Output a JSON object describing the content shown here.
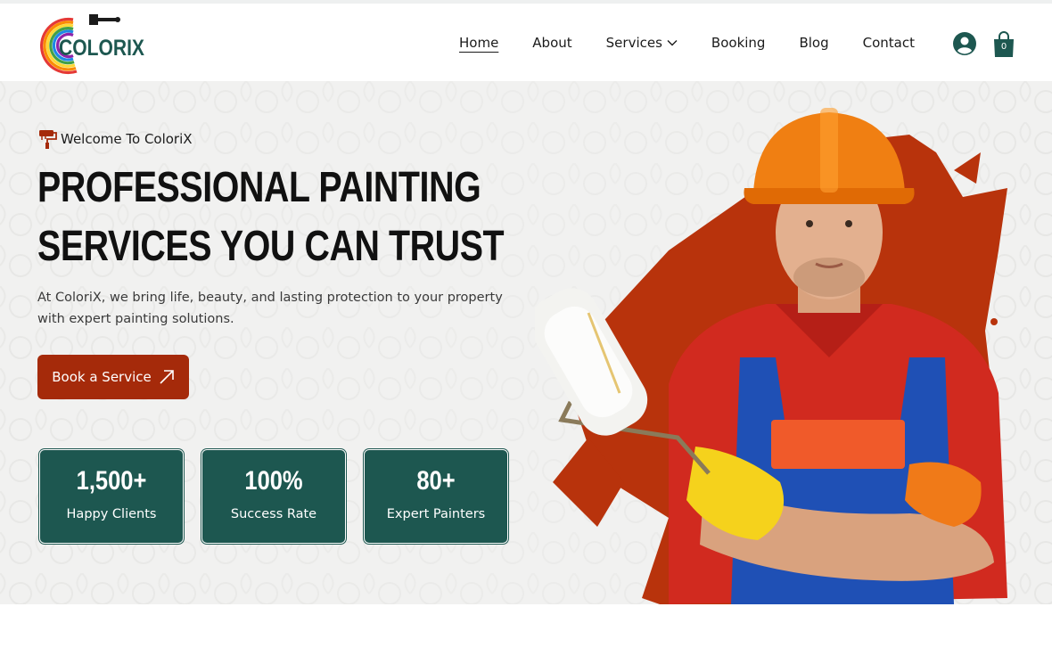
{
  "brand": {
    "logo_text": "COLORIX"
  },
  "nav": {
    "items": [
      {
        "label": "Home",
        "active": true
      },
      {
        "label": "About"
      },
      {
        "label": "Services",
        "has_dropdown": true
      },
      {
        "label": "Booking"
      },
      {
        "label": "Blog"
      },
      {
        "label": "Contact"
      }
    ]
  },
  "header": {
    "user_icon": "user-circle-icon",
    "cart_icon": "shopping-bag-icon",
    "cart_count": "0"
  },
  "hero": {
    "welcome": "Welcome To ColoriX",
    "title_line1": "PROFESSIONAL PAINTING",
    "title_line2": "SERVICES YOU CAN TRUST",
    "description": "At ColoriX, we bring life, beauty, and lasting protection to your property with expert painting solutions.",
    "cta_label": "Book a Service",
    "cta_icon": "arrow-up-right-icon",
    "stats": [
      {
        "value": "1,500+",
        "label": "Happy Clients"
      },
      {
        "value": "100%",
        "label": "Success Rate"
      },
      {
        "value": "80+",
        "label": "Expert Painters"
      }
    ]
  },
  "colors": {
    "accent": "#a52a0a",
    "stat_bg": "#1d5750",
    "hero_bg": "#f1f1f0"
  }
}
